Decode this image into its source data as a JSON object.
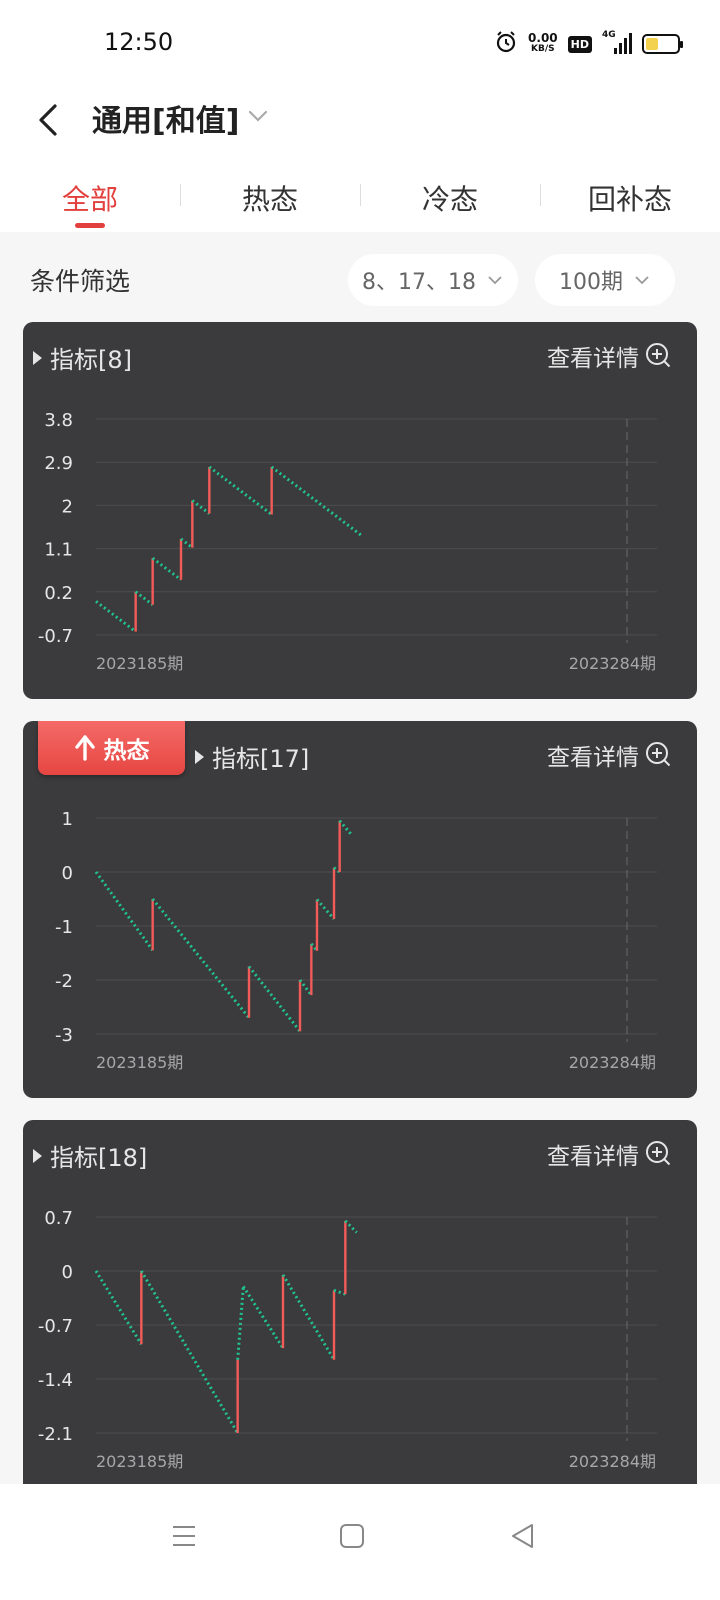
{
  "status_bar": {
    "time": "12:50",
    "net_speed_value": "0.00",
    "net_speed_unit": "KB/S",
    "hd_label": "HD",
    "signal_label": "4G",
    "battery_level": 0.4,
    "battery_color": "#f3d250"
  },
  "header": {
    "title": "通用[和值]",
    "back_icon": "chevron-left-icon",
    "dropdown_icon": "chevron-down-icon"
  },
  "tabs": [
    {
      "label": "全部",
      "active": true
    },
    {
      "label": "热态",
      "active": false
    },
    {
      "label": "冷态",
      "active": false
    },
    {
      "label": "回补态",
      "active": false
    }
  ],
  "filter": {
    "label": "条件筛选",
    "numbers_value": "8、17、18",
    "period_value": "100期"
  },
  "colors": {
    "accent": "#e2403d",
    "card_bg": "#3b3b3d",
    "rise": "#f25b58",
    "fall": "#1fc48e"
  },
  "cards": [
    {
      "title": "指标[8]",
      "detail_label": "查看详情",
      "badge": null,
      "chart_data": {
        "type": "line",
        "title": "指标[8]",
        "x_start_label": "2023185期",
        "x_end_label": "2023284期",
        "x_range": [
          2023185,
          2023284
        ],
        "yticks": [
          3.8,
          2.9,
          2,
          1.1,
          0.2,
          -0.7
        ],
        "ylim": [
          -0.7,
          3.8
        ],
        "grid": true,
        "decay_per_period": -0.09,
        "points": [
          [
            2023185,
            0.0
          ],
          [
            2023192,
            -0.63
          ],
          [
            2023192,
            0.2
          ],
          [
            2023195,
            -0.07
          ],
          [
            2023195,
            0.9
          ],
          [
            2023200,
            0.45
          ],
          [
            2023200,
            1.3
          ],
          [
            2023202,
            1.12
          ],
          [
            2023202,
            2.1
          ],
          [
            2023205,
            1.83
          ],
          [
            2023205,
            2.8
          ],
          [
            2023216,
            1.81
          ],
          [
            2023216,
            2.8
          ],
          [
            2023232,
            1.36
          ]
        ]
      }
    },
    {
      "title": "指标[17]",
      "detail_label": "查看详情",
      "badge": {
        "label": "热态",
        "icon": "arrow-up-icon"
      },
      "chart_data": {
        "type": "line",
        "title": "指标[17]",
        "x_start_label": "2023185期",
        "x_end_label": "2023284期",
        "x_range": [
          2023185,
          2023284
        ],
        "yticks": [
          1,
          0,
          -1,
          -2,
          -3
        ],
        "ylim": [
          -3,
          1
        ],
        "grid": true,
        "decay_per_period": -0.05,
        "points": [
          [
            2023185,
            0.0
          ],
          [
            2023195,
            -1.45
          ],
          [
            2023195,
            -0.5
          ],
          [
            2023212,
            -2.7
          ],
          [
            2023212,
            -1.75
          ],
          [
            2023221,
            -2.95
          ],
          [
            2023221,
            -2.0
          ],
          [
            2023223,
            -2.28
          ],
          [
            2023223,
            -1.33
          ],
          [
            2023224,
            -1.46
          ],
          [
            2023224,
            -0.51
          ],
          [
            2023227,
            -0.87
          ],
          [
            2023227,
            0.08
          ],
          [
            2023228,
            0.0
          ],
          [
            2023228,
            0.95
          ],
          [
            2023230,
            0.7
          ]
        ]
      }
    },
    {
      "title": "指标[18]",
      "detail_label": "查看详情",
      "badge": null,
      "chart_data": {
        "type": "line",
        "title": "指标[18]",
        "x_start_label": "2023185期",
        "x_end_label": "2023284期",
        "x_range": [
          2023185,
          2023284
        ],
        "yticks": [
          0.7,
          0,
          -0.7,
          -1.4,
          -2.1
        ],
        "ylim": [
          -2.1,
          0.7
        ],
        "grid": true,
        "decay_per_period": -0.05,
        "points": [
          [
            2023185,
            0.0
          ],
          [
            2023193,
            -0.95
          ],
          [
            2023193,
            0.0
          ],
          [
            2023210,
            -2.1
          ],
          [
            2023210,
            -1.15
          ],
          [
            2023211,
            -0.2
          ],
          [
            2023218,
            -1.0
          ],
          [
            2023218,
            -0.05
          ],
          [
            2023227,
            -1.15
          ],
          [
            2023227,
            -0.25
          ],
          [
            2023229,
            -0.3
          ],
          [
            2023229,
            0.65
          ],
          [
            2023231,
            0.5
          ]
        ]
      }
    }
  ],
  "bottom_nav": [
    {
      "icon": "menu-icon"
    },
    {
      "icon": "home-square-icon"
    },
    {
      "icon": "back-triangle-icon"
    }
  ]
}
